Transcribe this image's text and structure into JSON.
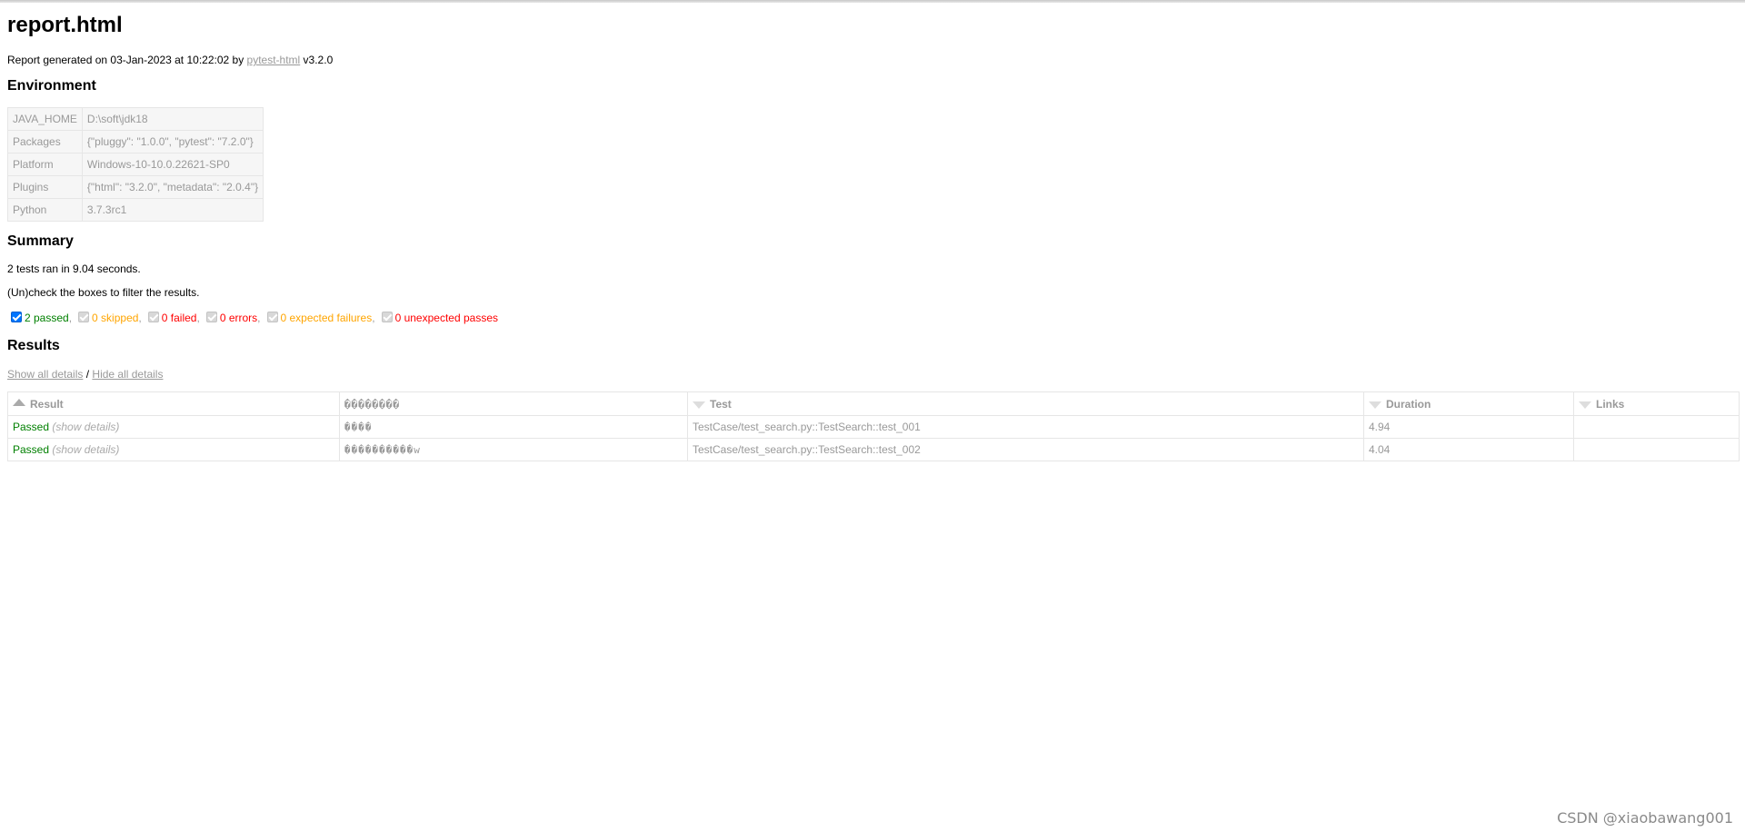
{
  "title": "report.html",
  "generated": {
    "prefix": "Report generated on 03-Jan-2023 at 10:22:02 by ",
    "link": "pytest-html",
    "suffix": " v3.2.0"
  },
  "environment": {
    "heading": "Environment",
    "rows": [
      {
        "key": "JAVA_HOME",
        "value": "D:\\soft\\jdk18"
      },
      {
        "key": "Packages",
        "value": "{\"pluggy\": \"1.0.0\", \"pytest\": \"7.2.0\"}"
      },
      {
        "key": "Platform",
        "value": "Windows-10-10.0.22621-SP0"
      },
      {
        "key": "Plugins",
        "value": "{\"html\": \"3.2.0\", \"metadata\": \"2.0.4\"}"
      },
      {
        "key": "Python",
        "value": "3.7.3rc1"
      }
    ]
  },
  "summary": {
    "heading": "Summary",
    "ran": "2 tests ran in 9.04 seconds.",
    "hint": "(Un)check the boxes to filter the results.",
    "filters": [
      {
        "label": "2 passed",
        "checked": true,
        "color": "#008000"
      },
      {
        "label": "0 skipped",
        "checked": false,
        "color": "#ffa500"
      },
      {
        "label": "0 failed",
        "checked": false,
        "color": "#ff0000"
      },
      {
        "label": "0 errors",
        "checked": false,
        "color": "#ff0000"
      },
      {
        "label": "0 expected failures",
        "checked": false,
        "color": "#ffa500"
      },
      {
        "label": "0 unexpected passes",
        "checked": false,
        "color": "#ff0000"
      }
    ]
  },
  "results": {
    "heading": "Results",
    "show_all": "Show all details",
    "slash": " / ",
    "hide_all": "Hide all details",
    "columns": [
      "Result",
      "��������",
      "Test",
      "Duration",
      "Links"
    ],
    "rows": [
      {
        "result": "Passed",
        "details": "(show details)",
        "desc": "����",
        "test": "TestCase/test_search.py::TestSearch::test_001",
        "duration": "4.94",
        "links": ""
      },
      {
        "result": "Passed",
        "details": "(show details)",
        "desc": "����������w",
        "test": "TestCase/test_search.py::TestSearch::test_002",
        "duration": "4.04",
        "links": ""
      }
    ]
  },
  "watermark": "CSDN @xiaobawang001"
}
